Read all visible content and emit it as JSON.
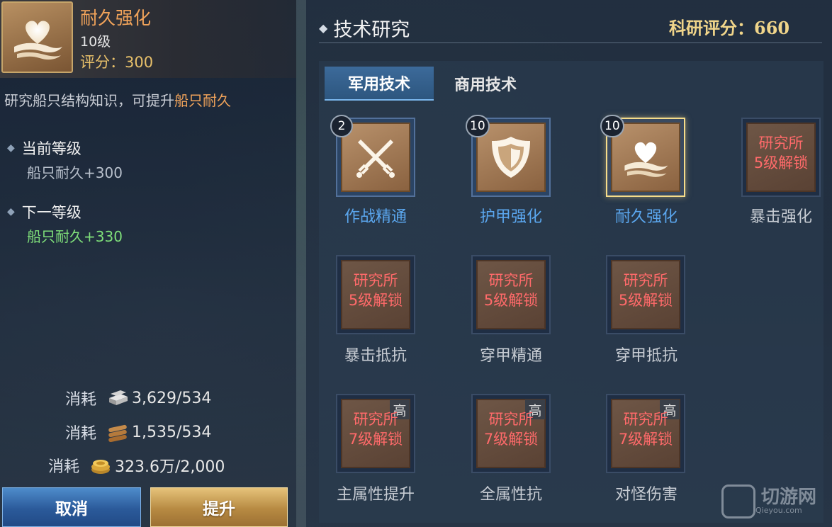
{
  "skill": {
    "title": "耐久强化",
    "level": "10级",
    "score": "评分：300",
    "desc_prefix": "研究船只结构知识，可提升",
    "desc_highlight": "船只耐久",
    "icon": "heart-icon"
  },
  "current": {
    "label": "当前等级",
    "value": "船只耐久+300"
  },
  "next": {
    "label": "下一等级",
    "value": "船只耐久+330"
  },
  "costs": [
    {
      "label": "消耗",
      "icon": "silver-ingot-icon",
      "value": "3,629/534"
    },
    {
      "label": "消耗",
      "icon": "wood-log-icon",
      "value": "1,535/534"
    },
    {
      "label": "消耗",
      "icon": "gold-coin-icon",
      "value": "323.6万/2,000"
    }
  ],
  "buttons": {
    "cancel": "取消",
    "upgrade": "提升"
  },
  "research": {
    "title": "技术研究",
    "score": "科研评分：660",
    "tabs": [
      "军用技术",
      "商用技术"
    ]
  },
  "nodes": [
    {
      "name": "作战精通",
      "level": "2",
      "state": "unlocked",
      "icon": "crossed-swords-icon"
    },
    {
      "name": "护甲强化",
      "level": "10",
      "state": "unlocked",
      "icon": "shield-icon"
    },
    {
      "name": "耐久强化",
      "level": "10",
      "state": "selected",
      "icon": "heart-icon"
    },
    {
      "name": "暴击强化",
      "lock1": "研究所",
      "lock2": "5级解锁",
      "state": "locked"
    },
    {
      "name": "暴击抵抗",
      "lock1": "研究所",
      "lock2": "5级解锁",
      "state": "locked"
    },
    {
      "name": "穿甲精通",
      "lock1": "研究所",
      "lock2": "5级解锁",
      "state": "locked"
    },
    {
      "name": "穿甲抵抗",
      "lock1": "研究所",
      "lock2": "5级解锁",
      "state": "locked"
    },
    {
      "name": "主属性提升",
      "lock1": "研究所",
      "lock2": "7级解锁",
      "tag": "高",
      "state": "locked"
    },
    {
      "name": "全属性抗",
      "lock1": "研究所",
      "lock2": "7级解锁",
      "tag": "高",
      "state": "locked"
    },
    {
      "name": "对怪伤害",
      "lock1": "研究所",
      "lock2": "7级解锁",
      "tag": "高",
      "state": "locked"
    }
  ],
  "watermark": {
    "text": "切游网",
    "sub": "Qieyou.com"
  },
  "colors": {
    "accent_orange": "#f1a35a",
    "unlocked_label": "#5ba7ef",
    "lock_red": "#ff6a6a",
    "score_gold": "#f0d58a",
    "next_green": "#7fe07a"
  }
}
